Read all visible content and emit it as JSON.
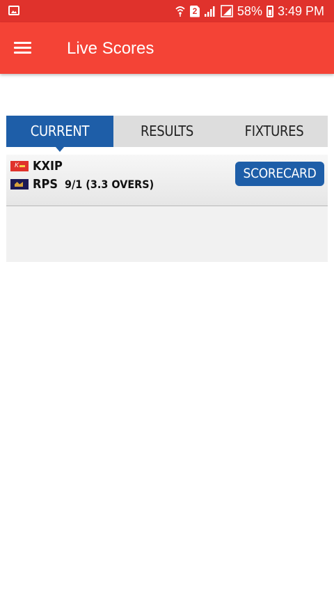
{
  "status_bar": {
    "battery": "58%",
    "time": "3:49 PM",
    "sim_slot": "2"
  },
  "app_bar": {
    "title": "Live Scores",
    "color": "#f44336"
  },
  "tabs": [
    {
      "label": "CURRENT",
      "active": true
    },
    {
      "label": "RESULTS",
      "active": false
    },
    {
      "label": "FIXTURES",
      "active": false
    }
  ],
  "match": {
    "team1": {
      "name": "KXIP",
      "flag_icon": "kxip-flag-icon"
    },
    "team2": {
      "name": "RPS",
      "score": "9/1 (3.3 OVERS)",
      "flag_icon": "rps-flag-icon"
    },
    "button_label": "SCORECARD"
  },
  "colors": {
    "accent_blue": "#1e5ea8",
    "status_bar": "#e0322c"
  }
}
